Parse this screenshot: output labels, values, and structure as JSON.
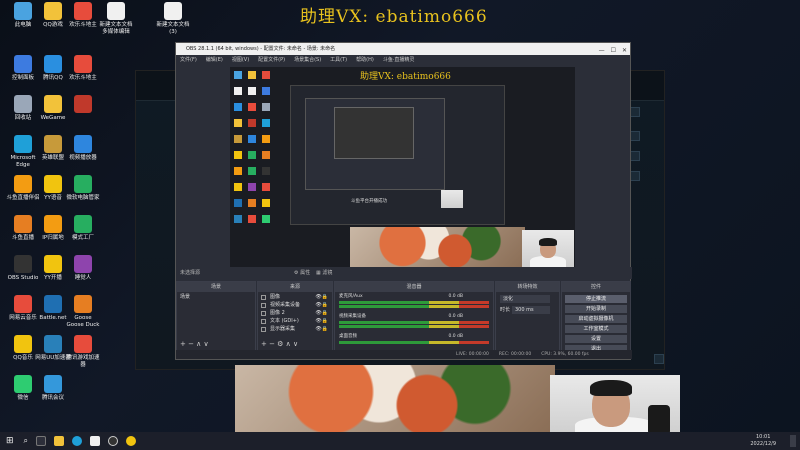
{
  "watermark": "助理VX: ebatimo666",
  "desktop_icons": [
    {
      "label": "此电脑",
      "color": "#4aa3e0"
    },
    {
      "label": "QQ游戏",
      "color": "#f2c23a"
    },
    {
      "label": "欢乐斗地主",
      "color": "#e74c3c"
    },
    {
      "label": "新建文本文档 多媒体编辑",
      "color": "#f0f0f0"
    },
    {
      "label": "新建文本文档 (3)",
      "color": "#f0f0f0"
    },
    {
      "label": "控制面板",
      "color": "#3d7be0"
    },
    {
      "label": "腾讯QQ",
      "color": "#2a8fe0"
    },
    {
      "label": "欢乐斗地主",
      "color": "#e74c3c"
    },
    {
      "label": "回收站",
      "color": "#9aa7b8"
    },
    {
      "label": "WeGame",
      "color": "#f2c23a"
    },
    {
      "label": "",
      "color": "#c0392b"
    },
    {
      "label": "Microsoft Edge",
      "color": "#1fa0d8"
    },
    {
      "label": "英雄联盟",
      "color": "#c79a3a"
    },
    {
      "label": "视频播放器",
      "color": "#2e86de"
    },
    {
      "label": "斗鱼直播伴侣",
      "color": "#f39c12"
    },
    {
      "label": "YY语音",
      "color": "#f1c40f"
    },
    {
      "label": "微软电脑管家",
      "color": "#27ae60"
    },
    {
      "label": "斗鱼直播",
      "color": "#e67e22"
    },
    {
      "label": "IP归属地",
      "color": "#f39c12"
    },
    {
      "label": "模式工厂",
      "color": "#27ae60"
    },
    {
      "label": "OBS Studio",
      "color": "#333333"
    },
    {
      "label": "YY开播",
      "color": "#f1c40f"
    },
    {
      "label": "睡觉人",
      "color": "#8e44ad"
    },
    {
      "label": "网易云音乐",
      "color": "#e74c3c"
    },
    {
      "label": "Battle.net",
      "color": "#1f6fb2"
    },
    {
      "label": "Goose Goose Duck",
      "color": "#e67e22"
    },
    {
      "label": "QQ音乐",
      "color": "#f1c40f"
    },
    {
      "label": "网易UU加速器",
      "color": "#2980b9"
    },
    {
      "label": "腾讯游戏加速器",
      "color": "#e74c3c"
    },
    {
      "label": "微信",
      "color": "#2ecc71"
    },
    {
      "label": "腾讯会议",
      "color": "#3498db"
    }
  ],
  "obs": {
    "title": "OBS 28.1.1 (64 bit, windows) - 配置文件: 未命名 - 场景: 未命名",
    "menu": [
      "文件(F)",
      "编辑(E)",
      "视图(V)",
      "配置文件(P)",
      "场景集合(S)",
      "工具(T)",
      "帮助(H)",
      "斗鱼·直播精灵"
    ],
    "preview_watermark": "助理VX: ebatimo666",
    "no_source_selected": "未选择源",
    "properties_label": "属性",
    "filters_label": "滤镜",
    "docks": {
      "scenes_title": "场景",
      "sources_title": "来源",
      "mixer_title": "混音器",
      "transitions_title": "转场特效",
      "controls_title": "控件"
    },
    "scenes": [
      "场景"
    ],
    "sources": [
      "图像",
      "视频采集设备",
      "图像 2",
      "文本 (GDI+)",
      "显示器采集"
    ],
    "mixer_channels": [
      {
        "name": "麦克风/Aux",
        "db": "0.0 dB"
      },
      {
        "name": "视频采集设备",
        "db": "0.0 dB"
      },
      {
        "name": "桌面音频",
        "db": "0.0 dB"
      }
    ],
    "transition": "淡化",
    "duration_label": "时长",
    "duration_value": "300 ms",
    "controls": [
      "停止推流",
      "开始录制",
      "启动虚拟摄像机",
      "工作室模式",
      "设置",
      "退出"
    ],
    "status": {
      "live": "LIVE: 00:00:00",
      "rec": "REC: 00:00:00",
      "cpu": "CPU: 3.9%, 60.00 fps"
    }
  },
  "preview_inner_text": "斗鱼平台开播成功",
  "taskbar": {
    "time": "10:01",
    "date": "2022/12/9"
  }
}
